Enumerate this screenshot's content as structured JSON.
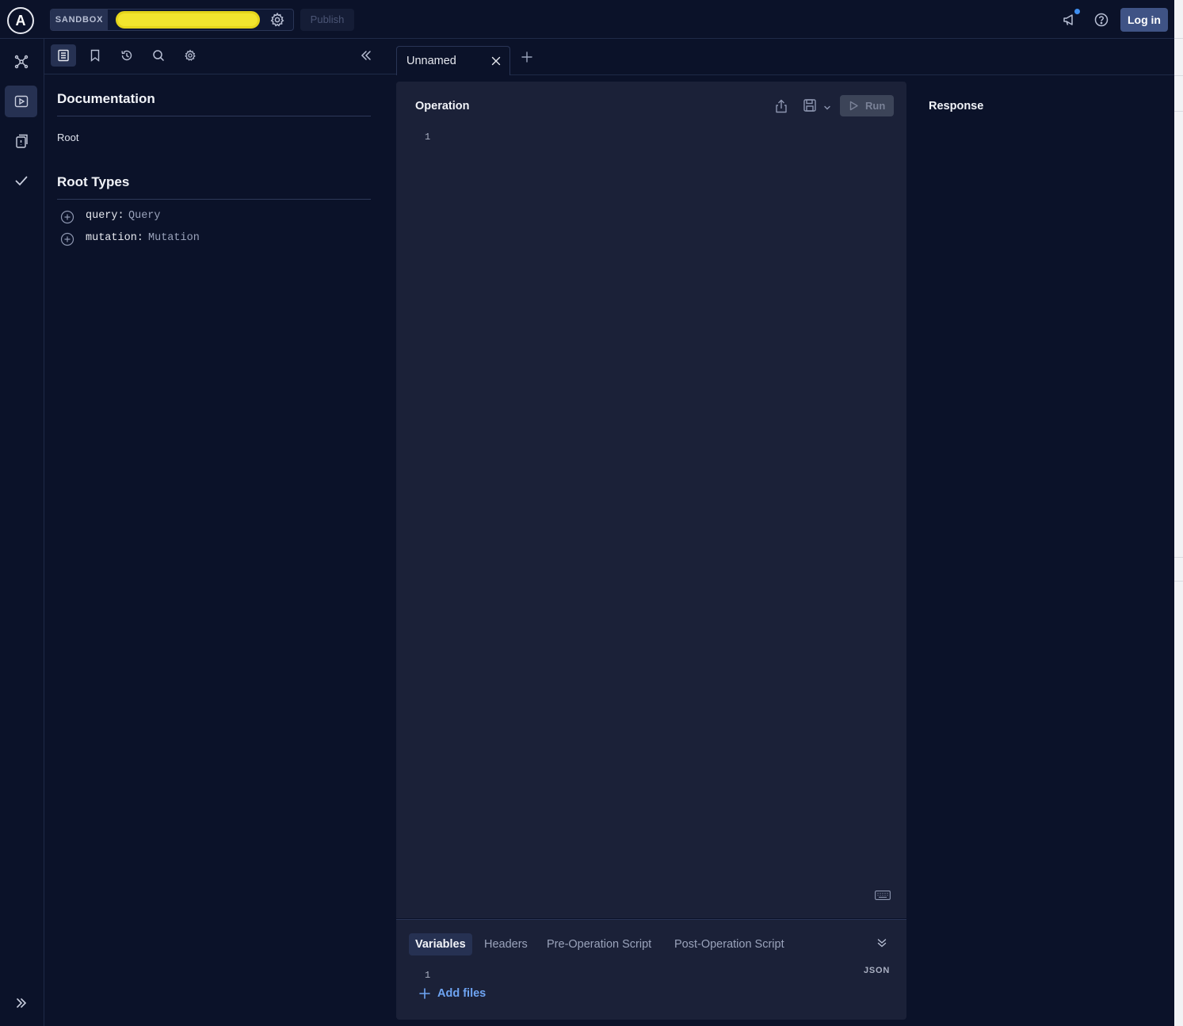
{
  "topbar": {
    "logo_text": "A",
    "sandbox_label": "SANDBOX",
    "endpoint_value": "",
    "publish_label": "Publish",
    "login_label": "Log in"
  },
  "rail": {
    "items": [
      "schema",
      "explorer",
      "checks",
      "launches"
    ],
    "active": "explorer"
  },
  "docs": {
    "toolbar": [
      "documentation",
      "bookmarks",
      "history",
      "search",
      "settings"
    ],
    "active_tool": "documentation",
    "heading": "Documentation",
    "breadcrumb": "Root",
    "root_types_heading": "Root Types",
    "root_types": [
      {
        "field": "query:",
        "type": "Query"
      },
      {
        "field": "mutation:",
        "type": "Mutation"
      }
    ]
  },
  "tabs": [
    {
      "label": "Unnamed"
    }
  ],
  "operation": {
    "title": "Operation",
    "run_label": "Run",
    "line_number": "1"
  },
  "variables": {
    "tabs": [
      "Variables",
      "Headers",
      "Pre-Operation Script",
      "Post-Operation Script"
    ],
    "active_tab": "Variables",
    "format_label": "JSON",
    "line_number": "1",
    "add_files_label": "Add files"
  },
  "response": {
    "title": "Response"
  },
  "colors": {
    "background": "#0b1229",
    "panel": "#1b2138",
    "accent": "#3f5385",
    "link": "#6ea4f3",
    "highlight": "#f2e52e",
    "notification": "#3f8ff0"
  }
}
